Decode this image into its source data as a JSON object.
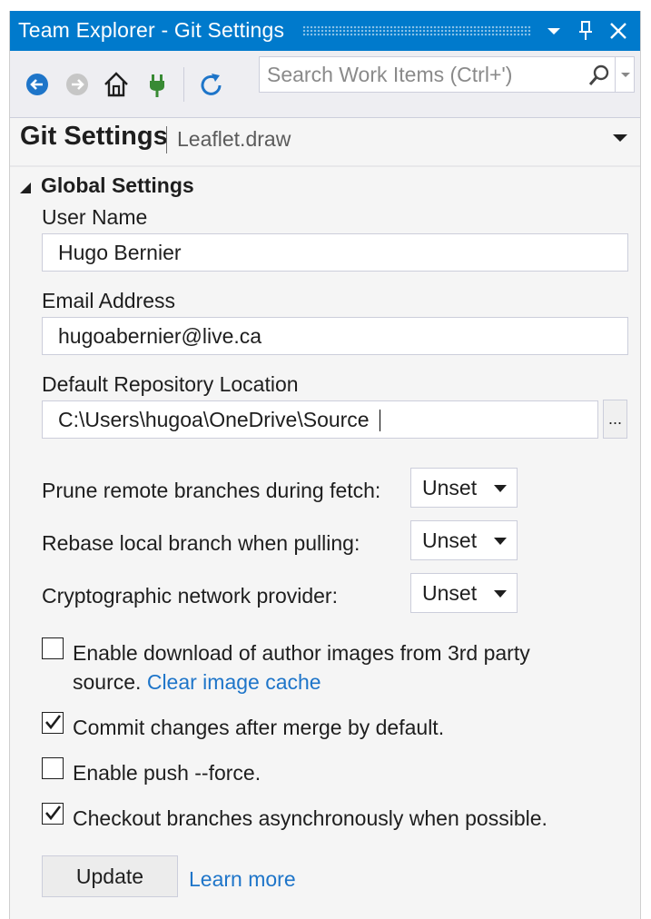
{
  "window": {
    "title": "Team Explorer - Git Settings"
  },
  "toolbar": {
    "search_placeholder": "Search Work Items (Ctrl+')",
    "search_value": ""
  },
  "header": {
    "title": "Git Settings",
    "repo": "Leaflet.draw"
  },
  "section": {
    "title": "Global Settings"
  },
  "form": {
    "user_name_label": "User Name",
    "user_name_value": "Hugo Bernier",
    "email_label": "Email Address",
    "email_value": "hugoabernier@live.ca",
    "repo_location_label": "Default Repository Location",
    "repo_location_value": "C:\\Users\\hugoa\\OneDrive\\Source",
    "browse_label": "..."
  },
  "options": [
    {
      "label": "Prune remote branches during fetch:",
      "value": "Unset"
    },
    {
      "label": "Rebase local branch when pulling:",
      "value": "Unset"
    },
    {
      "label": "Cryptographic network provider:",
      "value": "Unset"
    }
  ],
  "checkboxes": {
    "author_images_line1": "Enable download of author images from 3rd party",
    "author_images_line2": "source.",
    "author_images_link": "Clear image cache",
    "author_images_checked": false,
    "commit_after_merge": "Commit changes after merge by default.",
    "commit_after_merge_checked": true,
    "push_force": "Enable push --force.",
    "push_force_checked": false,
    "checkout_async": "Checkout branches asynchronously when possible.",
    "checkout_async_checked": true
  },
  "footer": {
    "update_label": "Update",
    "learn_more_label": "Learn more"
  },
  "colors": {
    "title_bar": "#007acc",
    "link": "#1e75c9",
    "plug_icon": "#388a34",
    "nav_icon": "#1e75c9"
  }
}
